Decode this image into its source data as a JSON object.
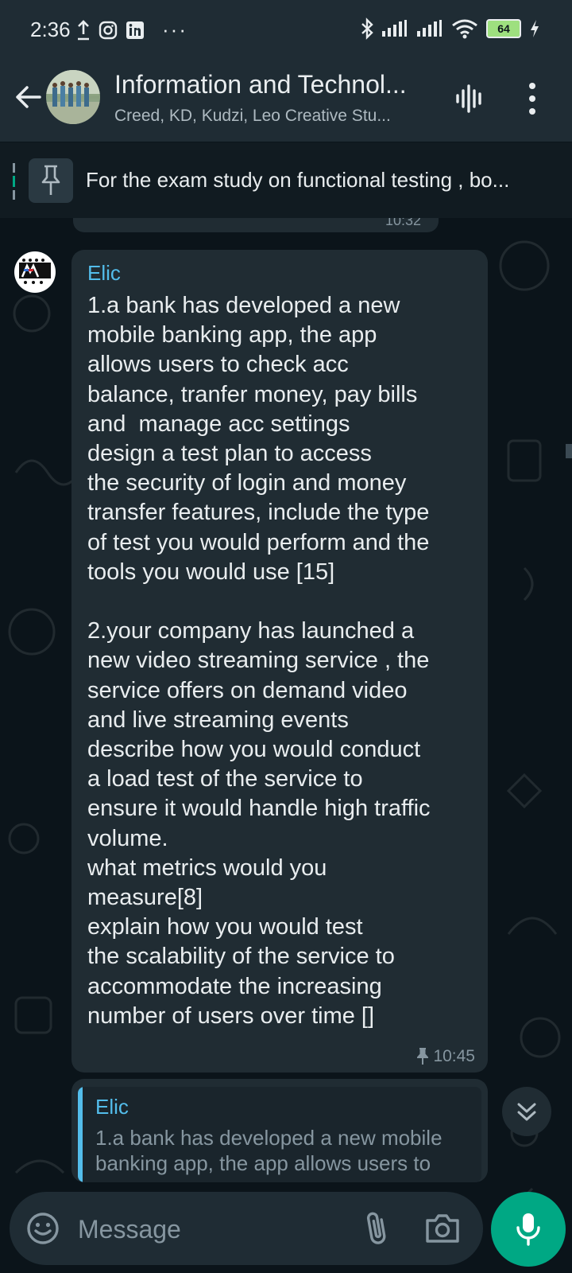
{
  "status_bar": {
    "time": "2:36",
    "battery": "64"
  },
  "header": {
    "title": "Information and Technol...",
    "subtitle": "Creed, KD, Kudzi, Leo Creative Stu..."
  },
  "pinned": {
    "text": "For the exam study on functional testing , bo..."
  },
  "previous_message": {
    "time": "10:32"
  },
  "message": {
    "sender": "Elic",
    "text": "1.a bank has developed a new\nmobile banking app, the app\nallows users to check acc\nbalance, tranfer money, pay bills\nand  manage acc settings\ndesign a test plan to access\nthe security of login and money\ntransfer features, include the type\nof test you would perform and the\ntools you would use [15]\n\n2.your company has launched a\nnew video streaming service , the\nservice offers on demand video\nand live streaming events\ndescribe how you would conduct\na load test of the service to\nensure it would handle high traffic\nvolume.\nwhat metrics would you\nmeasure[8]\nexplain how you would test\nthe scalability of the service to\naccommodate the increasing\nnumber of users over time []",
    "time": "10:45"
  },
  "reply": {
    "quoted_sender": "Elic",
    "quoted_text": "1.a bank has developed a new mobile banking app, the app allows users to"
  },
  "composer": {
    "placeholder": "Message"
  },
  "colors": {
    "accent": "#00a884",
    "sender_name": "#53bdeb",
    "bubble": "#202c33",
    "background": "#0b141a"
  }
}
